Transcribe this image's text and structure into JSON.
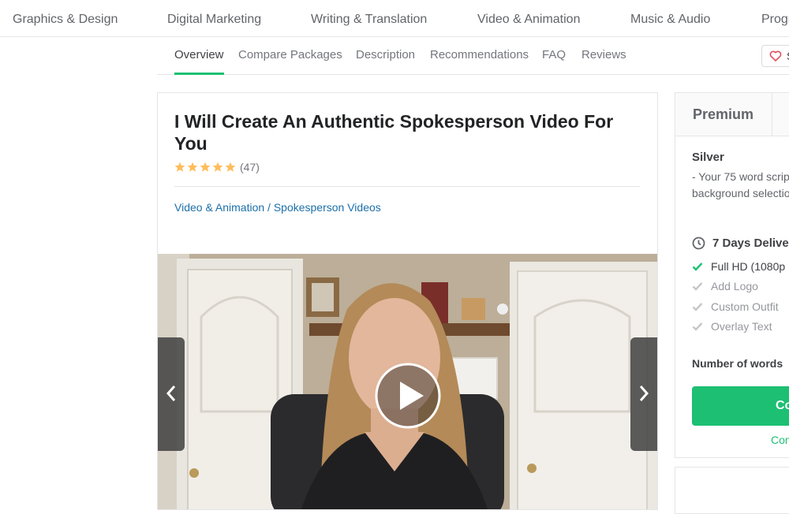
{
  "category_nav": {
    "items": [
      "Graphics & Design",
      "Digital Marketing",
      "Writing & Translation",
      "Video & Animation",
      "Music & Audio",
      "Progr"
    ]
  },
  "sub_nav": {
    "tabs": [
      "Overview",
      "Compare Packages",
      "Description",
      "Recommendations",
      "FAQ",
      "Reviews"
    ],
    "active": "Overview",
    "save_label": "S"
  },
  "gig": {
    "title": "I Will Create An Authentic Spokesperson Video For You",
    "rating_stars": 5,
    "rating_count": "(47)",
    "breadcrumb": {
      "category": "Video & Animation",
      "separator": "/",
      "subcategory": "Spokesperson Videos"
    }
  },
  "package": {
    "tab_label": "Premium",
    "name": "Silver",
    "description_lines": [
      "- Your 75 word scrip",
      "background selectio"
    ],
    "delivery": "7 Days Deliver",
    "features": [
      {
        "label": "Full HD (1080p",
        "included": true
      },
      {
        "label": "Add Logo",
        "included": false
      },
      {
        "label": "Custom Outfit",
        "included": false
      },
      {
        "label": "Overlay Text",
        "included": false
      }
    ],
    "words_label": "Number of words",
    "continue_label": "Co",
    "compare_label": "Con"
  },
  "colors": {
    "accent_green": "#1dbf73",
    "star_yellow": "#ffbe5b",
    "link_blue": "#1c6fa8",
    "heart_red": "#e0505e"
  }
}
